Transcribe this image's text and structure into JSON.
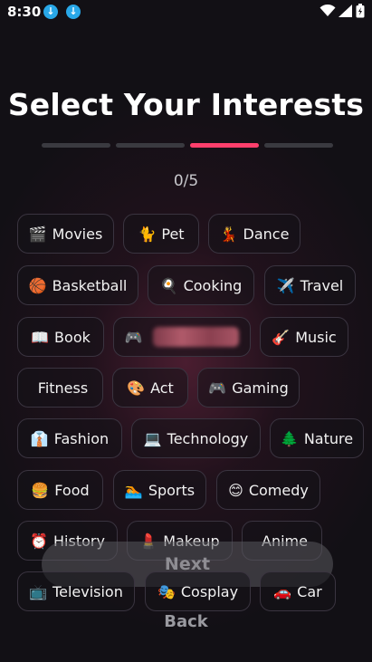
{
  "status_bar": {
    "time": "8:30"
  },
  "header": {
    "title": "Select Your Interests",
    "counter": "0/5"
  },
  "progress": {
    "steps": 4,
    "active_step": 3
  },
  "colors": {
    "accent": "#ff3f6c",
    "background": "#121015"
  },
  "interests": [
    {
      "emoji": "🎬",
      "label": "Movies"
    },
    {
      "emoji": "🐈",
      "label": "Pet"
    },
    {
      "emoji": "💃",
      "label": "Dance"
    },
    {
      "emoji": "🏀",
      "label": "Basketball"
    },
    {
      "emoji": "🍳",
      "label": "Cooking"
    },
    {
      "emoji": "✈️",
      "label": "Travel"
    },
    {
      "emoji": "📖",
      "label": "Book"
    },
    {
      "emoji": "🎮",
      "label": ""
    },
    {
      "emoji": "🎸",
      "label": "Music"
    },
    {
      "emoji": "",
      "label": "Fitness"
    },
    {
      "emoji": "🎨",
      "label": "Act"
    },
    {
      "emoji": "🎮",
      "label": "Gaming"
    },
    {
      "emoji": "👔",
      "label": "Fashion"
    },
    {
      "emoji": "💻",
      "label": "Technology"
    },
    {
      "emoji": "🌲",
      "label": "Nature"
    },
    {
      "emoji": "🍔",
      "label": "Food"
    },
    {
      "emoji": "🏊",
      "label": "Sports"
    },
    {
      "emoji": "😊",
      "label": "Comedy"
    },
    {
      "emoji": "⏰",
      "label": "History"
    },
    {
      "emoji": "💄",
      "label": "Makeup"
    },
    {
      "emoji": "",
      "label": "Anime"
    },
    {
      "emoji": "📺",
      "label": "Television"
    },
    {
      "emoji": "🎭",
      "label": "Cosplay"
    },
    {
      "emoji": "🚗",
      "label": "Car"
    }
  ],
  "buttons": {
    "next": "Next",
    "back": "Back"
  }
}
